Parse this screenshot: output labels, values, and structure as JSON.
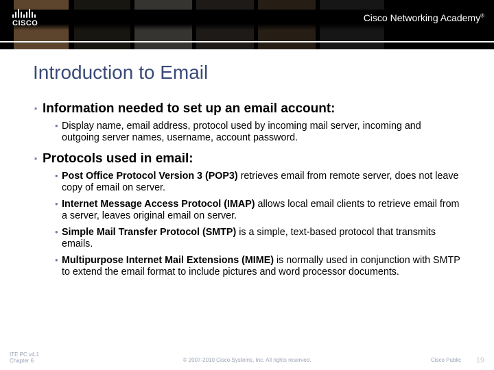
{
  "header": {
    "logo_word": "CISCO",
    "brand_text": "Cisco Networking Academy",
    "brand_tm": "®"
  },
  "title": "Introduction to Email",
  "sections": [
    {
      "heading": "Information needed to set up an email account:",
      "bullets": [
        {
          "lead": "",
          "text": "Display name, email address, protocol used by incoming mail server, incoming and outgoing server names, username, account password."
        }
      ]
    },
    {
      "heading": "Protocols used in email:",
      "bullets": [
        {
          "lead": "Post Office Protocol Version 3 (POP3)",
          "text": " retrieves email from remote server, does not leave copy of email on server."
        },
        {
          "lead": "Internet Message Access Protocol (IMAP)",
          "text": " allows local email clients to retrieve email from a server, leaves original email on server."
        },
        {
          "lead": "Simple Mail Transfer Protocol (SMTP)",
          "text": " is a simple, text-based protocol that transmits emails."
        },
        {
          "lead": "Multipurpose Internet Mail Extensions (MIME)",
          "text": " is normally used in conjunction with SMTP to extend the email format to include pictures and word processor documents."
        }
      ]
    }
  ],
  "footer": {
    "left_line1": "ITE PC v4.1",
    "left_line2": "Chapter 6",
    "center": "© 2007-2010 Cisco Systems, Inc. All rights reserved.",
    "public": "Cisco Public",
    "page": "19"
  }
}
